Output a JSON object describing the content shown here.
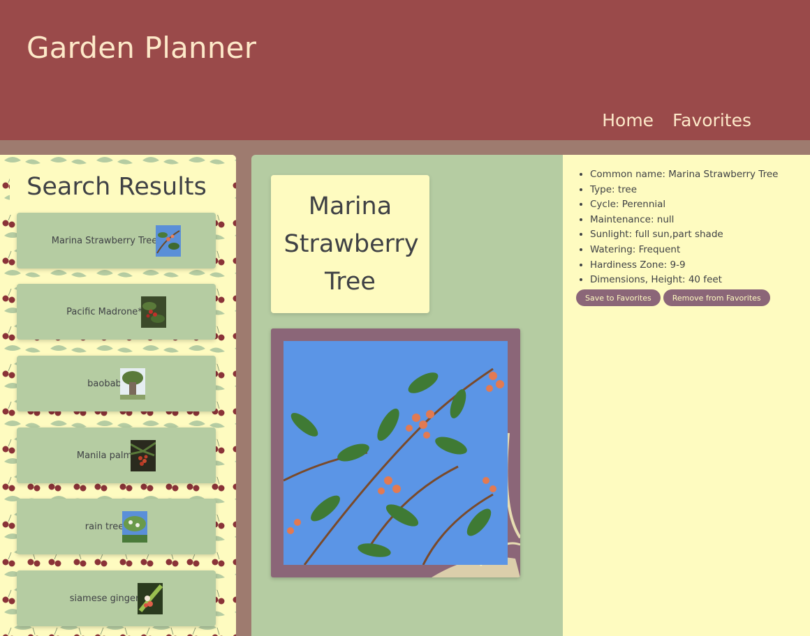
{
  "header": {
    "title": "Garden Planner",
    "nav": [
      {
        "label": "Home"
      },
      {
        "label": "Favorites"
      }
    ]
  },
  "search": {
    "title": "Search Results",
    "results": [
      {
        "name": "Marina Strawberry Tree"
      },
      {
        "name": "Pacific Madrone*"
      },
      {
        "name": "baobab"
      },
      {
        "name": "Manila palm"
      },
      {
        "name": "rain tree"
      },
      {
        "name": "siamese ginger"
      }
    ]
  },
  "plant": {
    "title": "Marina Strawberry Tree",
    "details": [
      "Common name: Marina Strawberry Tree",
      "Type: tree",
      "Cycle: Perennial",
      "Maintenance: null",
      "Sunlight: full sun,part shade",
      "Watering: Frequent",
      "Hardiness Zone: 9-9",
      "Dimensions, Height: 40 feet"
    ],
    "buttons": {
      "save": "Save to Favorites",
      "remove": "Remove from Favorites"
    }
  },
  "colors": {
    "header_bg": "#9a4a4a",
    "page_bg": "#9e7b6f",
    "panel_cream": "#fefbc0",
    "panel_sage": "#b5cca2",
    "accent_mauve": "#8b6678",
    "text": "#3f4145"
  }
}
